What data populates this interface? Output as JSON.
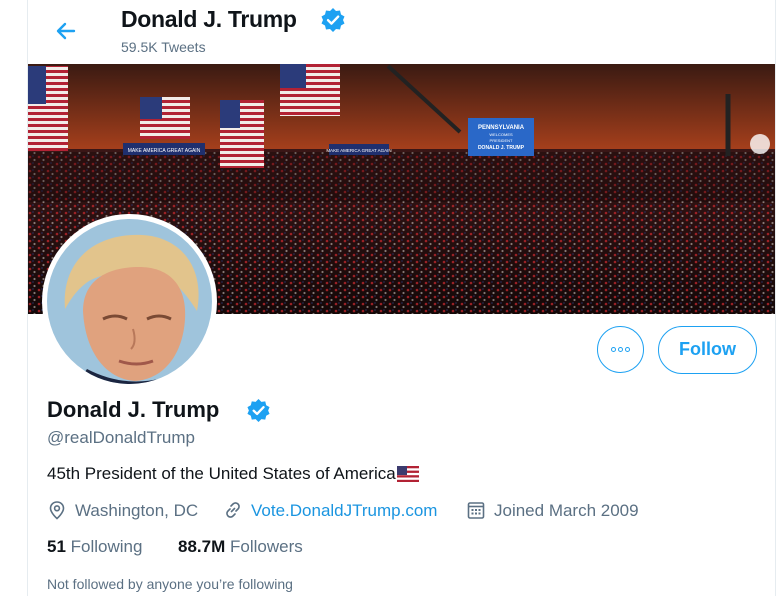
{
  "header": {
    "name": "Donald J. Trump",
    "tweet_count": "59.5K Tweets"
  },
  "banner": {
    "signs": [
      "MAKE AMERICA GREAT AGAIN",
      "MAKE AMERICA GREAT AGAIN"
    ],
    "screen": [
      "PENNSYLVANIA",
      "WELCOMES",
      "PRESIDENT",
      "DONALD J. TRUMP"
    ]
  },
  "actions": {
    "follow_label": "Follow"
  },
  "profile": {
    "name": "Donald J. Trump",
    "handle": "@realDonaldTrump",
    "bio": "45th President of the United States of America",
    "location": "Washington, DC",
    "website": "Vote.DonaldJTrump.com",
    "joined": "Joined March 2009"
  },
  "stats": {
    "following_count": "51",
    "following_label": "Following",
    "followers_count": "88.7M",
    "followers_label": "Followers"
  },
  "footer": {
    "not_followed": "Not followed by anyone you’re following"
  },
  "colors": {
    "accent": "#1da1f2",
    "link": "#1b95e0",
    "secondary_text": "#5b7083",
    "verified": "#1da1f2"
  }
}
